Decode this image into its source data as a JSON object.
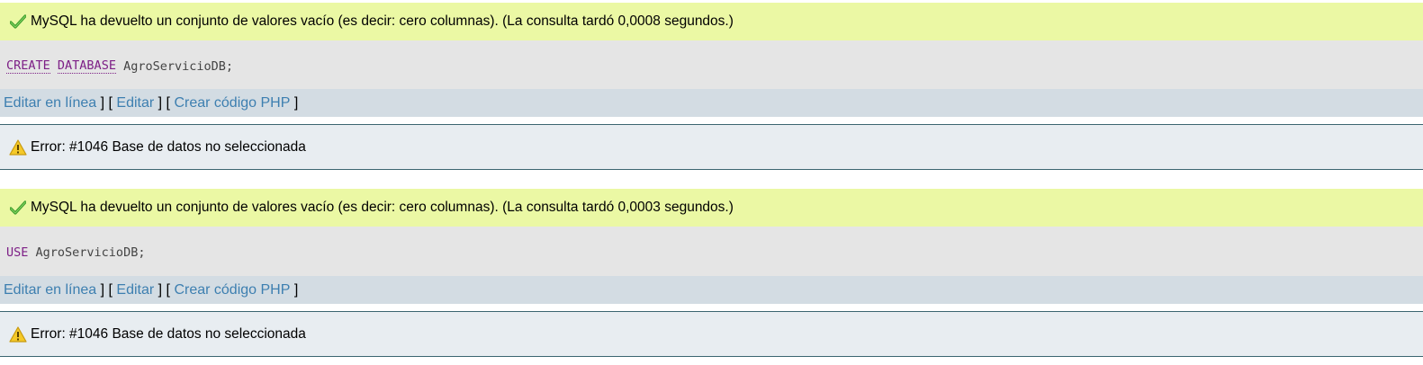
{
  "results": [
    {
      "success_message": "MySQL ha devuelto un conjunto de valores vacío (es decir: cero columnas). (La consulta tardó 0,0008 segundos.)",
      "sql": {
        "keywords": [
          "CREATE",
          "DATABASE"
        ],
        "rest": "AgroServicioDB;"
      },
      "links": {
        "inline_edit": "Editar en línea",
        "sep1": " ] [ ",
        "edit": "Editar",
        "sep2": " ] [ ",
        "php": "Crear código PHP",
        "end": " ]"
      },
      "error_message": "Error: #1046 Base de datos no seleccionada"
    },
    {
      "success_message": "MySQL ha devuelto un conjunto de valores vacío (es decir: cero columnas). (La consulta tardó 0,0003 segundos.)",
      "sql": {
        "keywords": [
          "USE"
        ],
        "rest": "AgroServicioDB;"
      },
      "links": {
        "inline_edit": "Editar en línea",
        "sep1": " ] [ ",
        "edit": "Editar",
        "sep2": " ] [ ",
        "php": "Crear código PHP",
        "end": " ]"
      },
      "error_message": "Error: #1046 Base de datos no seleccionada"
    }
  ],
  "icons": {
    "success": "check-icon",
    "error": "warning-icon"
  },
  "colors": {
    "success_bg": "#ebf8a4",
    "sql_bg": "#e5e5e5",
    "links_bg": "#d3dce3",
    "error_bg": "#e8edf1",
    "keyword": "#7d1f86",
    "link": "#3d7fb0"
  }
}
